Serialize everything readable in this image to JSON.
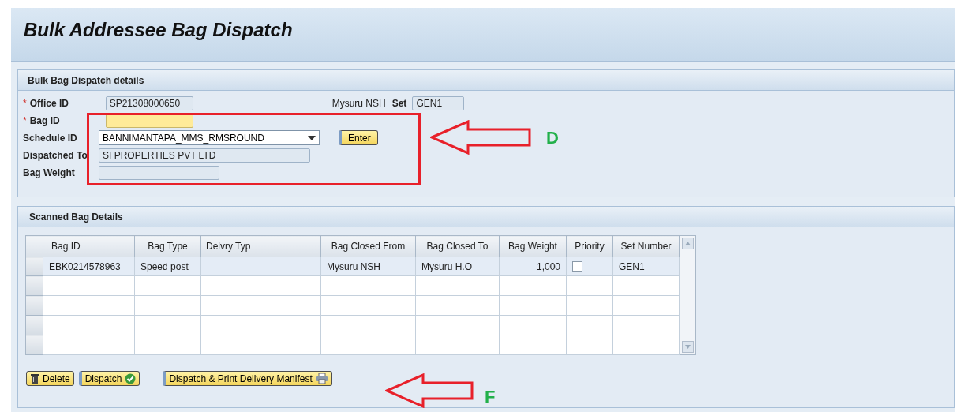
{
  "page": {
    "title": "Bulk Addressee Bag Dispatch"
  },
  "details": {
    "title": "Bulk Bag Dispatch details",
    "office": {
      "label": "Office ID",
      "mark": "*",
      "value": "SP21308000650",
      "office_name": "Mysuru NSH",
      "set_label": "Set",
      "set_value": "GEN1"
    },
    "fields": [
      {
        "kind": "text",
        "label": "Bag ID",
        "mark": "*",
        "focused": true
      },
      {
        "kind": "dropdown",
        "label": "Schedule ID",
        "value": "BANNIMANTAPA_MMS_RMSROUND",
        "button": "Enter"
      },
      {
        "kind": "text",
        "label": "Dispatched To",
        "focused": false,
        "value": "SI PROPERTIES PVT LTD"
      },
      {
        "kind": "text",
        "label": "Bag Weight",
        "focused": false
      }
    ]
  },
  "scanned": {
    "title": "Scanned Bag Details",
    "columns": [
      "Bag ID",
      "Bag Type",
      "Delvry Typ",
      "Bag Closed From",
      "Bag Closed To",
      "Bag Weight",
      "Priority",
      "Set Number"
    ],
    "rows": [
      {
        "selected": false,
        "bag_id": "EBK0214578963",
        "bag_type": "Speed post",
        "delivery_type": "",
        "closed_from": "Mysuru NSH",
        "closed_to": "Mysuru H.O",
        "weight": "1,000",
        "priority": false,
        "set_number": "GEN1"
      }
    ]
  },
  "actions": [
    {
      "kind": "delete",
      "label": "Delete"
    },
    {
      "kind": "dispatch",
      "label": "Dispatch"
    },
    {
      "kind": "print",
      "label": "Dispatch & Print Delivery Manifest"
    }
  ],
  "annotations": [
    {
      "kind": "box-arrow",
      "letter": "D"
    },
    {
      "kind": "arrow",
      "letter": "F"
    }
  ]
}
